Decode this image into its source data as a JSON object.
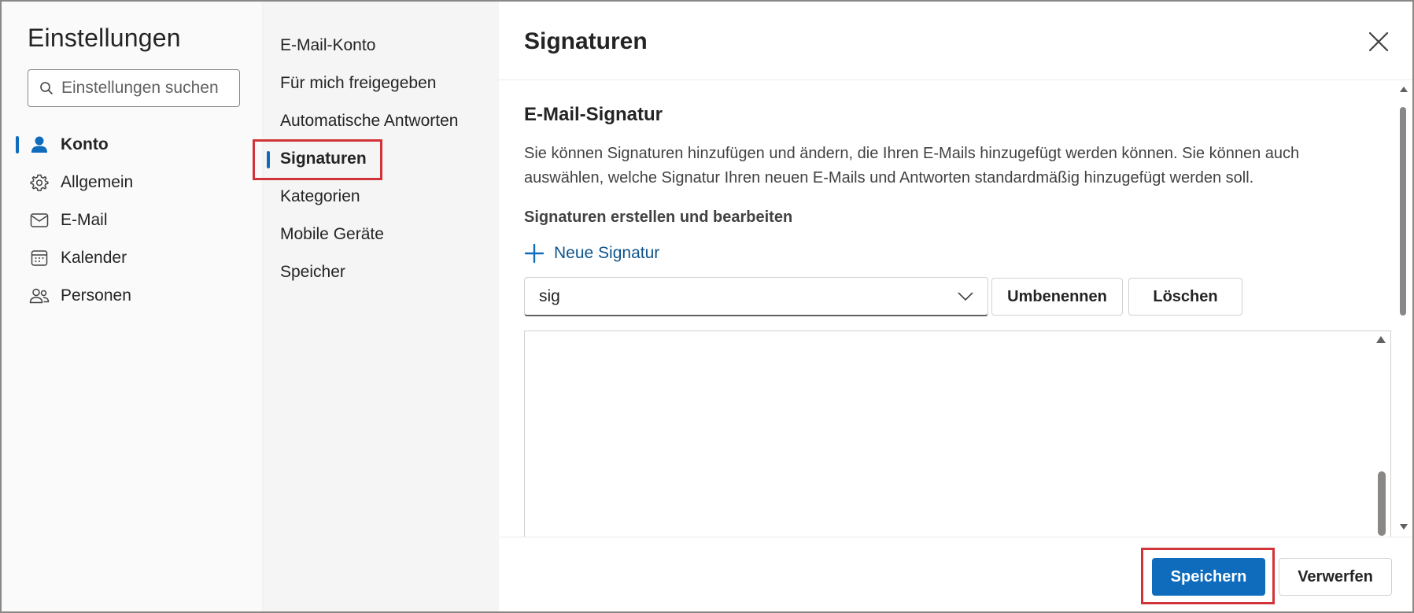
{
  "dialog": {
    "title": "Einstellungen",
    "close_icon": "close-icon"
  },
  "search": {
    "placeholder": "Einstellungen suchen",
    "icon": "search-icon"
  },
  "nav": {
    "items": [
      {
        "label": "Konto",
        "icon": "person-icon",
        "active": true
      },
      {
        "label": "Allgemein",
        "icon": "gear-icon",
        "active": false
      },
      {
        "label": "E-Mail",
        "icon": "mail-icon",
        "active": false
      },
      {
        "label": "Kalender",
        "icon": "calendar-icon",
        "active": false
      },
      {
        "label": "Personen",
        "icon": "people-icon",
        "active": false
      }
    ]
  },
  "subnav": {
    "items": [
      {
        "label": "E-Mail-Konto",
        "active": false
      },
      {
        "label": "Für mich freigegeben",
        "active": false
      },
      {
        "label": "Automatische Antworten",
        "active": false
      },
      {
        "label": "Signaturen",
        "active": true
      },
      {
        "label": "Kategorien",
        "active": false
      },
      {
        "label": "Mobile Geräte",
        "active": false
      },
      {
        "label": "Speicher",
        "active": false
      }
    ]
  },
  "panel": {
    "title": "Signaturen",
    "section_title": "E-Mail-Signatur",
    "description": "Sie können Signaturen hinzufügen und ändern, die Ihren E-Mails hinzugefügt werden können. Sie können auch auswählen, welche Signatur Ihren neuen E-Mails und Antworten standardmäßig hinzugefügt werden soll.",
    "sub_heading": "Signaturen erstellen und bearbeiten",
    "new_signature_label": "Neue Signatur",
    "selected_signature": "sig",
    "rename_label": "Umbenennen",
    "delete_label": "Löschen",
    "editor_content": ""
  },
  "footer": {
    "save_label": "Speichern",
    "discard_label": "Verwerfen"
  },
  "colors": {
    "accent": "#0f6cbd",
    "highlight": "#d13438"
  }
}
